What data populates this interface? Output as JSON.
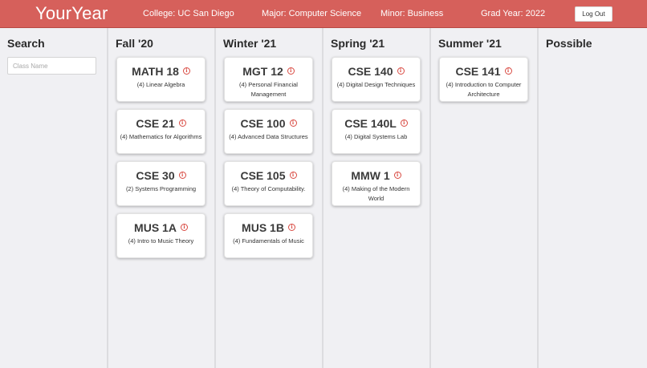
{
  "header": {
    "brand": "YourYear",
    "college": "College: UC San Diego",
    "major": "Major: Computer Science",
    "minor": "Minor: Business",
    "grad_year": "Grad Year: 2022",
    "logout_label": "Log Out",
    "background_color": "#d6605b"
  },
  "search": {
    "title": "Search",
    "placeholder": "Class Name",
    "value": ""
  },
  "quarters": [
    {
      "title": "Fall '20",
      "courses": [
        {
          "code": "MATH 18",
          "desc": "(4) Linear Algebra"
        },
        {
          "code": "CSE 21",
          "desc": "(4) Mathematics for Algorithms"
        },
        {
          "code": "CSE 30",
          "desc": "(2) Systems Programming"
        },
        {
          "code": "MUS 1A",
          "desc": "(4) Intro to Music Theory"
        }
      ]
    },
    {
      "title": "Winter '21",
      "courses": [
        {
          "code": "MGT 12",
          "desc": "(4) Personal Financial Management"
        },
        {
          "code": "CSE 100",
          "desc": "(4) Advanced Data Structures"
        },
        {
          "code": "CSE 105",
          "desc": "(4) Theory of Computability."
        },
        {
          "code": "MUS 1B",
          "desc": "(4) Fundamentals of Music"
        }
      ]
    },
    {
      "title": "Spring '21",
      "courses": [
        {
          "code": "CSE 140",
          "desc": "(4) Digital Design Techniques"
        },
        {
          "code": "CSE 140L",
          "desc": "(4) Digital Systems Lab"
        },
        {
          "code": "MMW 1",
          "desc": "(4) Making of the Modern World"
        }
      ]
    },
    {
      "title": "Summer '21",
      "courses": [
        {
          "code": "CSE 141",
          "desc": "(4) Introduction to Computer Architecture"
        }
      ]
    },
    {
      "title": "Possible",
      "courses": []
    }
  ],
  "icons": {
    "info": "info-icon",
    "info_color": "#d94a42"
  }
}
